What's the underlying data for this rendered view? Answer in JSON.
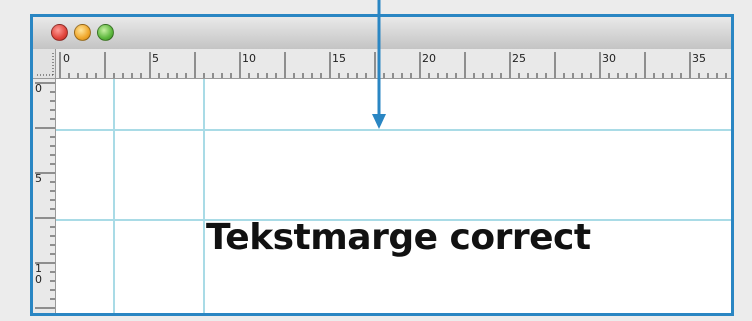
{
  "window": {
    "traffic_lights": [
      "close",
      "minimize",
      "zoom"
    ]
  },
  "ruler": {
    "horizontal_labels": [
      "0",
      "5",
      "10",
      "15",
      "20",
      "25",
      "30",
      "35"
    ],
    "vertical_labels": [
      "0",
      "5",
      "1",
      "0"
    ]
  },
  "canvas": {
    "sample_text": "Tekstmarge correct"
  },
  "colors": {
    "accent": "#2a86c3",
    "guide": "#a9dbe6",
    "close": "#e0443b",
    "minimize": "#f0a62a",
    "zoom": "#5cb73d"
  },
  "icons": [
    "arrow-down-icon"
  ]
}
